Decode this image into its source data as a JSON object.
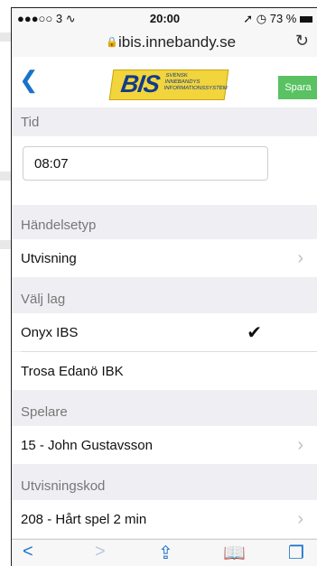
{
  "status_bar": {
    "carrier": "●●●○○ 3",
    "wifi_icon": "wifi-icon",
    "time": "20:00",
    "location_icon": "location-arrow-icon",
    "alarm_icon": "alarm-icon",
    "battery_percent": "73 %",
    "battery_icon": "battery-icon"
  },
  "browser": {
    "url": "ibis.innebandy.se",
    "lock_icon": "lock-icon",
    "reload_icon": "reload-icon"
  },
  "header": {
    "back_icon": "chevron-left-icon",
    "logo_text": "BIS",
    "logo_subtitle_1": "SVENSK",
    "logo_subtitle_2": "INNEBANDYS",
    "logo_subtitle_3": "INFORMATIONSSYSTEM",
    "save_label": "Spara",
    "save_color": "#5ac262"
  },
  "form": {
    "time_section": {
      "title": "Tid",
      "value": "08:07"
    },
    "event_type": {
      "title": "Händelsetyp",
      "value": "Utvisning"
    },
    "team": {
      "title": "Välj lag",
      "options": [
        {
          "label": "Onyx IBS",
          "selected": true
        },
        {
          "label": "Trosa Edanö IBK",
          "selected": false
        }
      ]
    },
    "player": {
      "title": "Spelare",
      "value": "15 - John Gustavsson"
    },
    "penalty_code": {
      "title": "Utvisningskod",
      "value": "208 - Hårt spel 2 min"
    }
  },
  "toolbar": {
    "back": "<",
    "forward": ">",
    "share_icon": "share-icon",
    "bookmarks_icon": "book-icon",
    "tabs_icon": "tabs-icon"
  },
  "colors": {
    "accent": "#1a73c9",
    "group_background": "#efeff3",
    "logo_yellow": "#f2d53c"
  }
}
